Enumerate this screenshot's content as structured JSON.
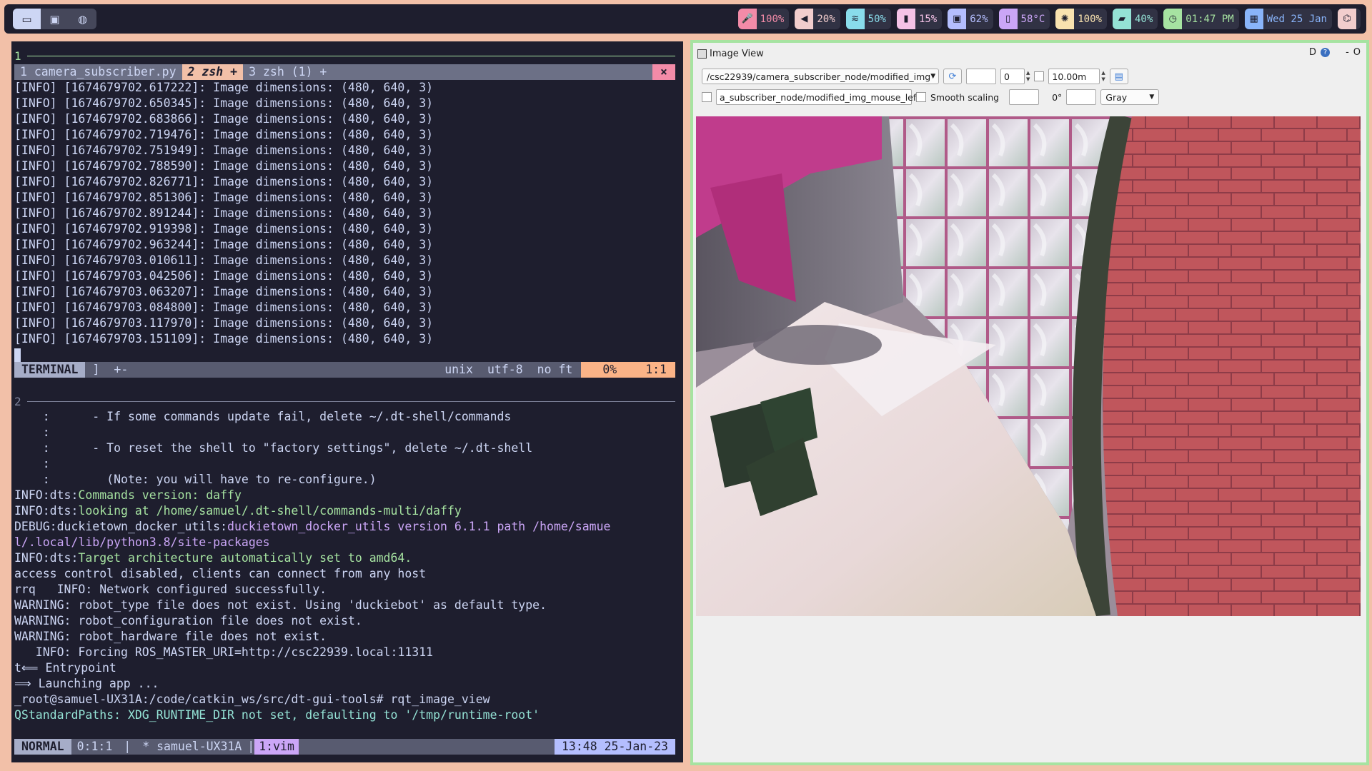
{
  "launcher": {
    "icons": [
      "window-icon",
      "terminal-icon",
      "globe-icon"
    ]
  },
  "status": [
    {
      "icon": "microphone-icon",
      "value": "100%",
      "color": "#f38ba8"
    },
    {
      "icon": "volume-icon",
      "value": "20%",
      "color": "#f2cdcd"
    },
    {
      "icon": "wifi-icon",
      "value": "50%",
      "color": "#89dceb"
    },
    {
      "icon": "memory-icon",
      "value": "15%",
      "color": "#f5c2e7"
    },
    {
      "icon": "cpu-icon",
      "value": "62%",
      "color": "#b4befe"
    },
    {
      "icon": "thermometer-icon",
      "value": "58°C",
      "color": "#cba6f7"
    },
    {
      "icon": "brightness-icon",
      "value": "100%",
      "color": "#f9e2af"
    },
    {
      "icon": "battery-icon",
      "value": "40%",
      "color": "#94e2d5"
    },
    {
      "icon": "clock-icon",
      "value": "01:47 PM",
      "color": "#a6e3a1"
    },
    {
      "icon": "calendar-icon",
      "value": "Wed 25 Jan",
      "color": "#89b4fa"
    },
    {
      "icon": "network-icon",
      "value": "",
      "color": "#f2cdcd"
    }
  ],
  "vim": {
    "window_number": "1",
    "tabs": {
      "tab1": "1 camera_subscriber.py",
      "tab2": "2 zsh +",
      "tab3": "3 zsh (1) +",
      "close": "×"
    },
    "log_lines": [
      "[INFO] [1674679702.617222]: Image dimensions: (480, 640, 3)",
      "[INFO] [1674679702.650345]: Image dimensions: (480, 640, 3)",
      "[INFO] [1674679702.683866]: Image dimensions: (480, 640, 3)",
      "[INFO] [1674679702.719476]: Image dimensions: (480, 640, 3)",
      "[INFO] [1674679702.751949]: Image dimensions: (480, 640, 3)",
      "[INFO] [1674679702.788590]: Image dimensions: (480, 640, 3)",
      "[INFO] [1674679702.826771]: Image dimensions: (480, 640, 3)",
      "[INFO] [1674679702.851306]: Image dimensions: (480, 640, 3)",
      "[INFO] [1674679702.891244]: Image dimensions: (480, 640, 3)",
      "[INFO] [1674679702.919398]: Image dimensions: (480, 640, 3)",
      "[INFO] [1674679702.963244]: Image dimensions: (480, 640, 3)",
      "[INFO] [1674679703.010611]: Image dimensions: (480, 640, 3)",
      "[INFO] [1674679703.042506]: Image dimensions: (480, 640, 3)",
      "[INFO] [1674679703.063207]: Image dimensions: (480, 640, 3)",
      "[INFO] [1674679703.084800]: Image dimensions: (480, 640, 3)",
      "[INFO] [1674679703.117970]: Image dimensions: (480, 640, 3)",
      "[INFO] [1674679703.151109]: Image dimensions: (480, 640, 3)"
    ],
    "statusline": {
      "mode": "TERMINAL",
      "bracket": "]",
      "modified": "+-",
      "format": "unix",
      "encoding": "utf-8",
      "filetype": "no ft",
      "percent": "0%",
      "position": "1:1"
    }
  },
  "shell": {
    "window_number": "2",
    "lines": [
      {
        "a": "    :      - If some commands update fail, delete ~/.dt-shell/commands",
        "b": "",
        "cls": ""
      },
      {
        "a": "    :",
        "b": "",
        "cls": ""
      },
      {
        "a": "    :      - To reset the shell to \"factory settings\", delete ~/.dt-shell",
        "b": "",
        "cls": ""
      },
      {
        "a": "    :",
        "b": "",
        "cls": ""
      },
      {
        "a": "    :        (Note: you will have to re-configure.)",
        "b": "",
        "cls": ""
      },
      {
        "a": "INFO:dts:",
        "b": "Commands version: daffy",
        "cls": "c-green"
      },
      {
        "a": "INFO:dts:",
        "b": "looking at /home/samuel/.dt-shell/commands-multi/daffy",
        "cls": "c-green"
      },
      {
        "a": "DEBUG:duckietown_docker_utils:",
        "b": "duckietown_docker_utils version 6.1.1 path /home/samue",
        "cls": "c-purple"
      },
      {
        "a": "",
        "b": "l/.local/lib/python3.8/site-packages",
        "cls": "c-purple"
      },
      {
        "a": "INFO:dts:",
        "b": "Target architecture automatically set to amd64.",
        "cls": "c-green"
      },
      {
        "a": "access control disabled, clients can connect from any host",
        "b": "",
        "cls": ""
      },
      {
        "a": "rrq   INFO: Network configured successfully.",
        "b": "",
        "cls": ""
      },
      {
        "a": "WARNING: robot_type file does not exist. Using 'duckiebot' as default type.",
        "b": "",
        "cls": ""
      },
      {
        "a": "WARNING: robot_configuration file does not exist.",
        "b": "",
        "cls": ""
      },
      {
        "a": "WARNING: robot_hardware file does not exist.",
        "b": "",
        "cls": ""
      },
      {
        "a": "   INFO: Forcing ROS_MASTER_URI=http://csc22939.local:11311",
        "b": "",
        "cls": ""
      },
      {
        "a": "t⟸ Entrypoint",
        "b": "",
        "cls": ""
      },
      {
        "a": "⟹ Launching app ...",
        "b": "",
        "cls": ""
      },
      {
        "a": "_root@samuel-UX31A:/code/catkin_ws/src/dt-gui-tools# rqt_image_view",
        "b": "",
        "cls": ""
      },
      {
        "a": "",
        "b": "QStandardPaths: XDG_RUNTIME_DIR not set, defaulting to '/tmp/runtime-root'",
        "cls": "c-teal"
      }
    ]
  },
  "tmux": {
    "mode": "NORMAL",
    "session": "0:1:1",
    "host": "* samuel-UX31A",
    "window": "1:vim",
    "clock": "13:48 25-Jan-23"
  },
  "image_view": {
    "title": "Image View",
    "window_controls": {
      "d": "D",
      "help": "?",
      "minimize": "-",
      "close": "O"
    },
    "topic": "/csc22939/camera_subscriber_node/modified_img",
    "refresh_icon": "refresh-icon",
    "value_field": "0",
    "max_range": "10.00m",
    "save_icon": "save-icon",
    "mouse_topic": "a_subscriber_node/modified_img_mouse_left",
    "smooth_scaling": "Smooth scaling",
    "rotation": "0°",
    "color_scheme": "Gray"
  }
}
